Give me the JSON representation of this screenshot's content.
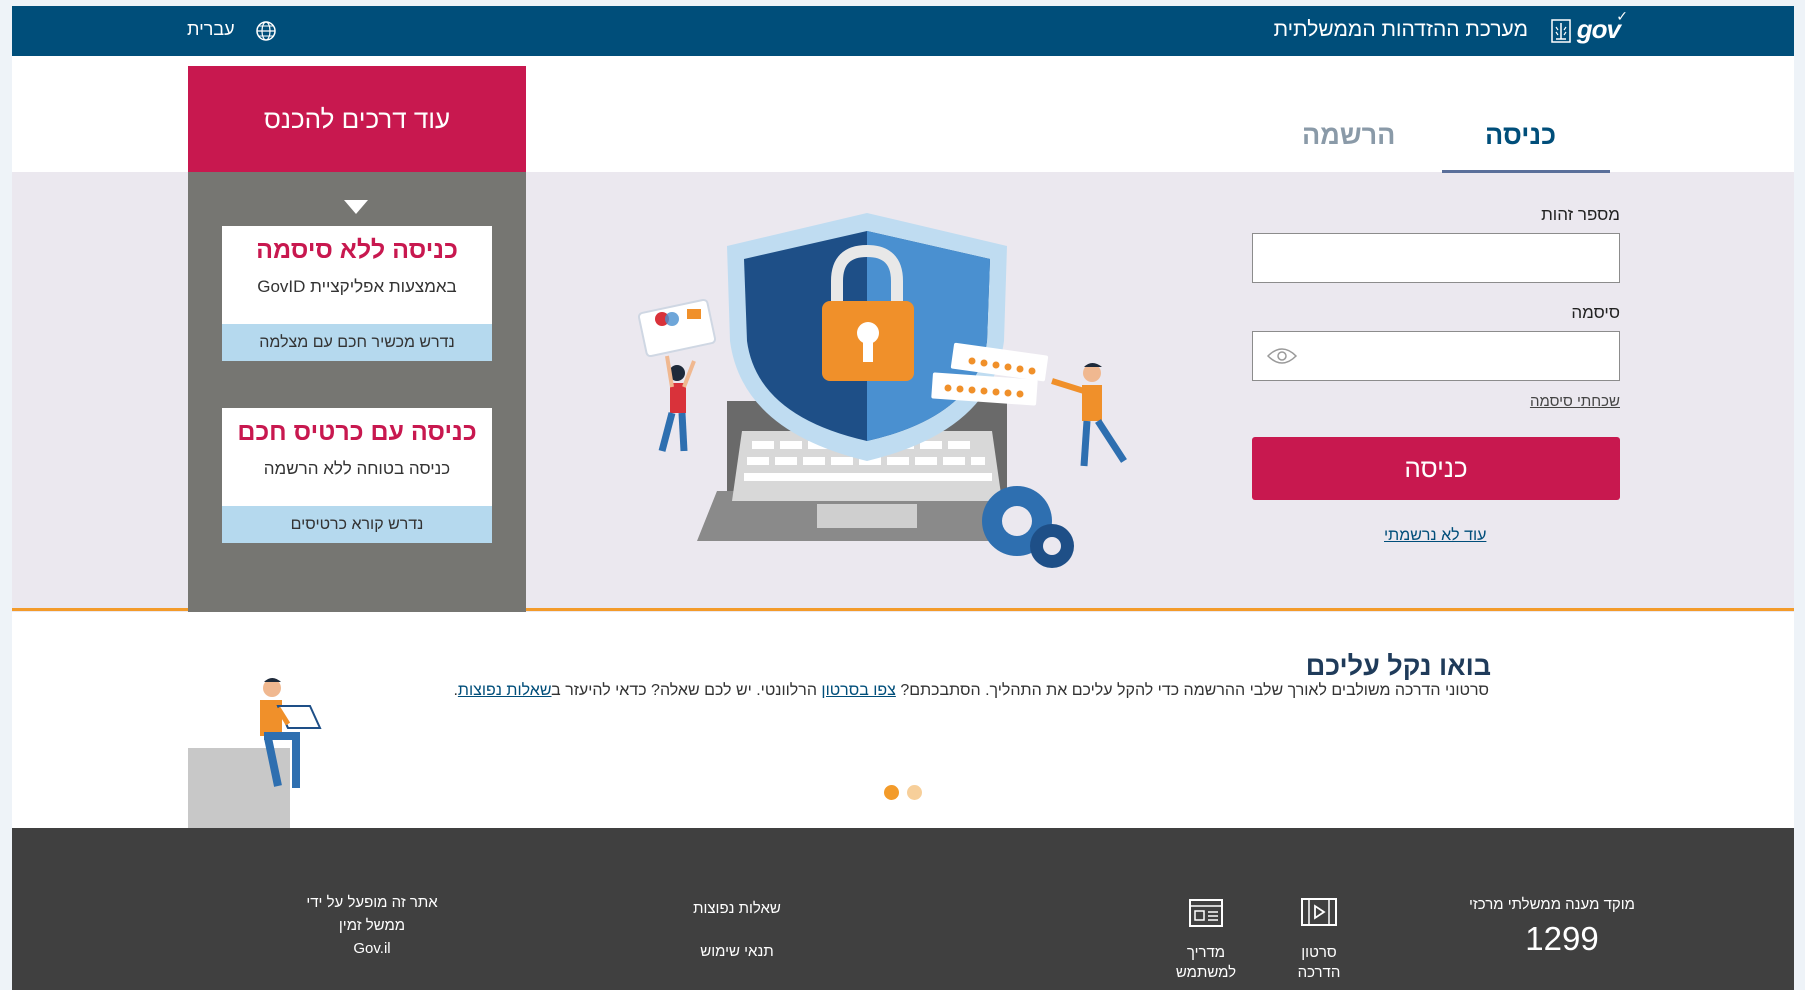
{
  "header": {
    "system_title": "מערכת ההזדהות הממשלתית",
    "logo_text": "gov",
    "language": "עברית"
  },
  "side_panel": {
    "title": "עוד דרכים להכנס",
    "cards": [
      {
        "title": "כניסה ללא סיסמה",
        "subtitle": "באמצעות אפליקציית GovID",
        "requirement": "נדרש מכשיר חכם עם מצלמה"
      },
      {
        "title": "כניסה עם כרטיס חכם",
        "subtitle": "כניסה בטוחה ללא הרשמה",
        "requirement": "נדרש קורא כרטיסים"
      }
    ]
  },
  "tabs": {
    "login": "כניסה",
    "register": "הרשמה"
  },
  "form": {
    "id_label": "מספר זהות",
    "id_value": "",
    "password_label": "סיסמה",
    "password_value": "",
    "forgot_password": "שכחתי סיסמה",
    "submit_label": "כניסה",
    "not_registered": "עוד לא נרשמתי"
  },
  "help": {
    "title": "בואו נקל עליכם",
    "text_before": "סרטוני הדרכה משולבים לאורך שלבי ההרשמה כדי להקל עליכם את התהליך. הסתבכתם? ",
    "watch_link": "צפו בסרטון",
    "text_middle": " הרלוונטי. יש לכם שאלה? כדאי להיעזר ב",
    "faq_link": "שאלות נפוצות",
    "text_end": ".",
    "carousel_active": 1,
    "carousel_total": 2
  },
  "footer": {
    "call_center_label": "מוקד מענה ממשלתי מרכזי",
    "call_center_number": "1299",
    "video_label": "סרטון הדרכה",
    "guide_label": "מדריך למשתמש",
    "faq": "שאלות נפוצות",
    "terms": "תנאי שימוש",
    "operator_line1": "אתר זה מופעל על ידי",
    "operator_line2": "ממשל זמין",
    "operator_line3": "Gov.il"
  },
  "colors": {
    "header_bg": "#004e7a",
    "accent_red": "#c8184f",
    "panel_grey": "#767672",
    "band_grey": "#ebe8ef",
    "orange": "#f39b2a",
    "footer_bg": "#404040",
    "card_footer_blue": "#b5d9ee"
  },
  "icons": [
    "globe-icon",
    "state-emblem-icon",
    "eye-icon",
    "video-icon",
    "guide-icon"
  ]
}
